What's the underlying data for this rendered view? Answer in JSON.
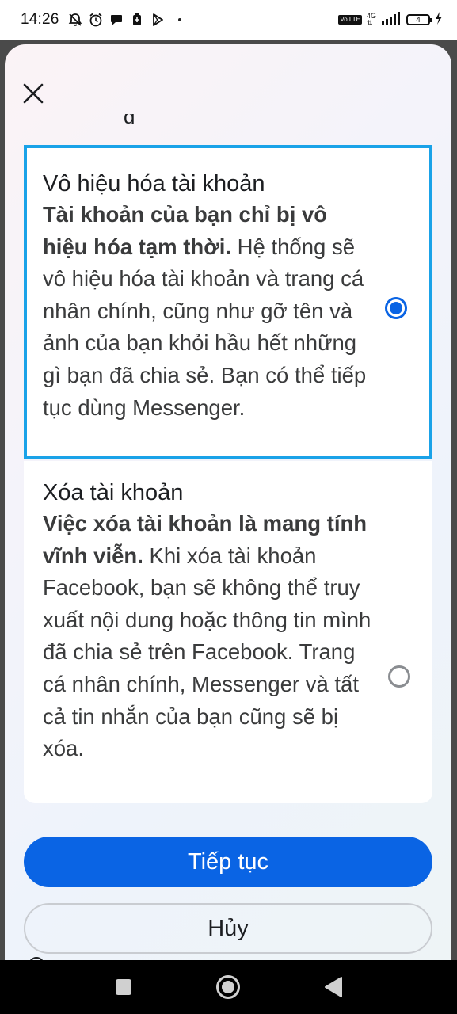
{
  "status_bar": {
    "time": "14:26",
    "network": "4G",
    "volte": "Vo LTE",
    "battery": "4"
  },
  "sheet": {
    "close_icon": "close-icon",
    "options": [
      {
        "title": "Vô hiệu hóa tài khoản",
        "desc_bold": "Tài khoản của bạn chỉ bị vô hiệu hóa tạm thời.",
        "desc": " Hệ thống sẽ vô hiệu hóa tài khoản và trang cá nhân chính, cũng như gỡ tên và ảnh của bạn khỏi hầu hết những gì bạn đã chia sẻ. Bạn có thể tiếp tục dùng Messenger.",
        "selected": true
      },
      {
        "title": "Xóa tài khoản",
        "desc_bold": "Việc xóa tài khoản là mang tính vĩnh viễn.",
        "desc": " Khi xóa tài khoản Facebook, bạn sẽ không thể truy xuất nội dung hoặc thông tin mình đã chia sẻ trên Facebook. Trang cá nhân chính, Messenger và tất cả tin nhắn của bạn cũng sẽ bị xóa.",
        "selected": false
      }
    ],
    "continue_label": "Tiếp tục",
    "cancel_label": "Hủy"
  },
  "colors": {
    "accent": "#0a64e4",
    "selected_border": "#1aa2e8"
  }
}
